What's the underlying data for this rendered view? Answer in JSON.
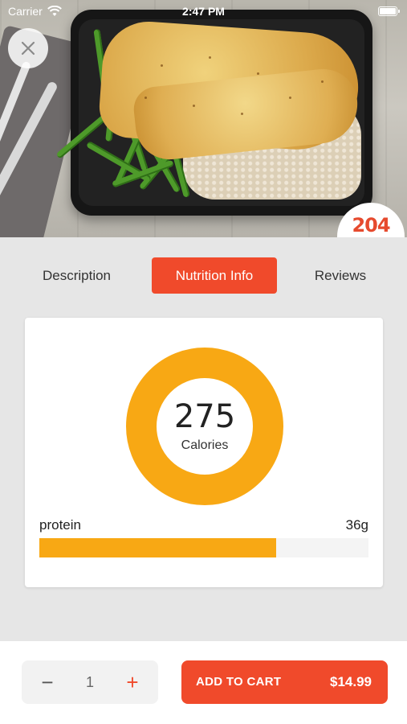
{
  "status_bar": {
    "carrier": "Carrier",
    "time": "2:47 PM",
    "wifi_icon": "wifi-icon",
    "battery_icon": "battery-icon"
  },
  "hero": {
    "close_icon": "close-icon",
    "logo_text": "204"
  },
  "tabs": [
    {
      "label": "Description",
      "active": false
    },
    {
      "label": "Nutrition Info",
      "active": true
    },
    {
      "label": "Reviews",
      "active": false
    }
  ],
  "nutrition": {
    "calories_value": "275",
    "calories_label": "Calories",
    "nutrients": [
      {
        "name": "protein",
        "amount": "36g",
        "fill_fraction": 0.72
      }
    ]
  },
  "cart_bar": {
    "minus_label": "−",
    "quantity": "1",
    "plus_label": "+",
    "add_to_cart_label": "ADD TO CART",
    "price": "$14.99"
  },
  "colors": {
    "accent": "#f04a2b",
    "chart": "#f8a814",
    "background": "#e6e6e6"
  }
}
